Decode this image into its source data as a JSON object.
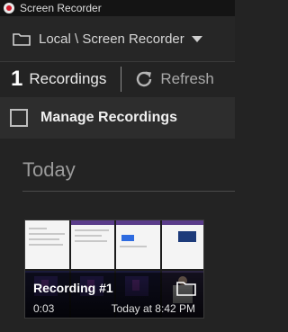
{
  "window": {
    "title": "Screen Recorder",
    "icon": "record-icon"
  },
  "location": {
    "path": "Local \\ Screen Recorder",
    "icon": "folder-icon",
    "dropdown_icon": "chevron-down-icon"
  },
  "toolbar": {
    "count": "1",
    "recordings_label": "Recordings",
    "refresh_label": "Refresh",
    "refresh_icon": "refresh-icon"
  },
  "manage": {
    "label": "Manage Recordings",
    "checked": false
  },
  "sections": [
    {
      "heading": "Today",
      "recordings": [
        {
          "title": "Recording #1",
          "duration": "0:03",
          "date": "Today at 8:42 PM",
          "folder_icon": "folder-icon"
        }
      ]
    }
  ],
  "colors": {
    "background": "#232323",
    "titlebar": "#141414",
    "accent_record": "#d21b2b"
  }
}
